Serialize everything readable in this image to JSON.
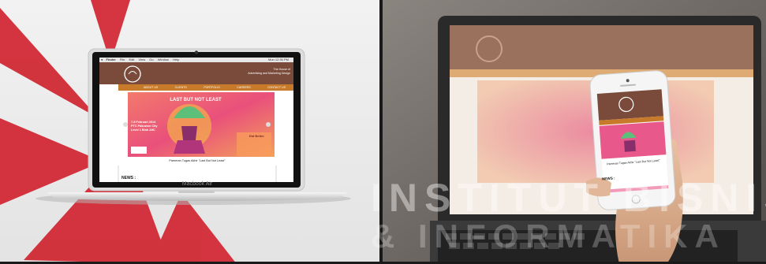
{
  "left_laptop": {
    "model_label": "Macbook Air",
    "menu_bar": [
      "Finder",
      "File",
      "Edit",
      "View",
      "Go",
      "Window",
      "Help"
    ],
    "clock": "Mon 12:30 PM",
    "site": {
      "tagline_line1": "The House of",
      "tagline_line2": "Advertising and Marketing Design",
      "nav": [
        "ABOUT US",
        "CLIENTS",
        "PORTFOLIO",
        "CAREERS",
        "CONTACT US"
      ],
      "banner_title": "LAST BUT NOT LEAST",
      "banner_date": "7-8 Februari 2014",
      "banner_place": "PTC Pakuwon City",
      "banner_level": "Level 1 Blok A9C",
      "banner_right_title": "Eat Better",
      "caption": "Pameran Tugas Akhir \"Last But Not Least\"",
      "news_label": "NEWS :"
    }
  },
  "right_phone": {
    "caption": "Pameran Tugas Akhir \"Last But Not Least\"",
    "news_label": "NEWS :"
  },
  "watermark": {
    "line1": "INSTITUT BISNIS",
    "line2": "& INFORMATIKA"
  },
  "colors": {
    "site_header": "#7a4b3a",
    "site_nav": "#c77a2a",
    "banner_pink": "#e86a6a",
    "logo_red": "#c8202a"
  }
}
